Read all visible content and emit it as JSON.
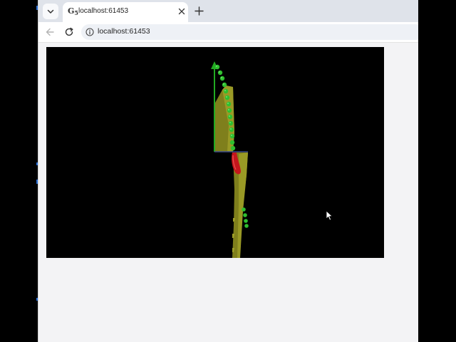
{
  "browser": {
    "tab": {
      "favicon_text": "G",
      "favicon_sub": "5",
      "title": "localhost:61453"
    },
    "address_bar": {
      "url": "localhost:61453"
    },
    "icons": {
      "tab_list": "chevron-down-icon",
      "close_tab": "close-icon",
      "new_tab": "plus-icon",
      "back": "arrow-left-icon",
      "reload": "reload-icon",
      "site_info": "info-icon"
    }
  },
  "scene": {
    "background": "#000000",
    "colors": {
      "sphere": "#33cc33",
      "axis": "#22aa22",
      "surface": "#8a8a1e",
      "marker": "#c4161c"
    }
  }
}
